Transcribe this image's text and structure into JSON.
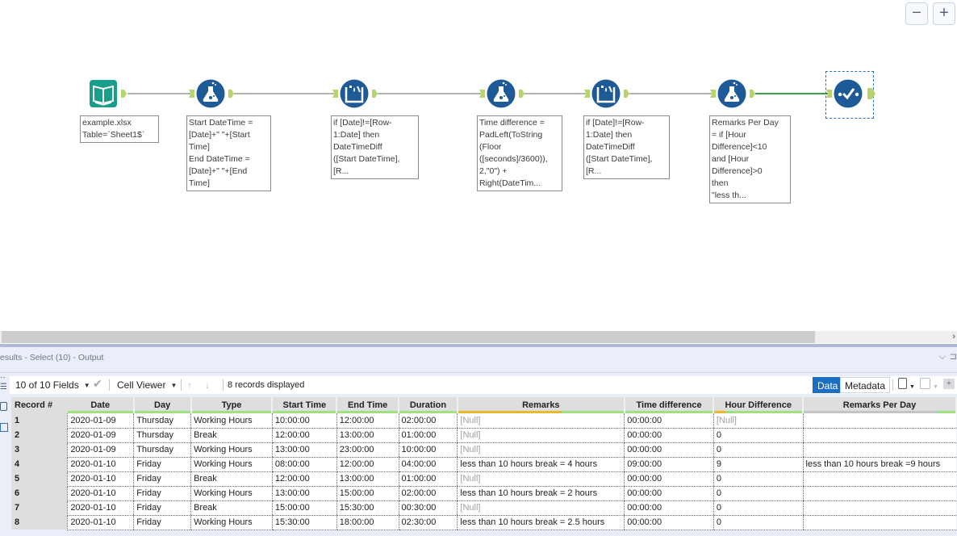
{
  "canvas": {
    "zoom_out_label": "−",
    "zoom_in_label": "+",
    "tools": [
      {
        "id": "input",
        "type": "input-data",
        "icon": "book-icon",
        "color": "#1a9e8c",
        "annotation": "example.xlsx\nTable=`Sheet1$`"
      },
      {
        "id": "formula1",
        "type": "formula",
        "icon": "flask-icon",
        "color": "#1e5a96",
        "annotation": "Start DateTime =\n[Date]+\" \"+[Start\nTime]\nEnd DateTime =\n[Date]+\" \"+[End\nTime]"
      },
      {
        "id": "multirow1",
        "type": "multi-row-formula",
        "icon": "multi-row-icon",
        "color": "#1e5a96",
        "annotation": "if [Date]!=[Row-\n1:Date] then\nDateTimeDiff\n([Start DateTime],\n[R..."
      },
      {
        "id": "formula2",
        "type": "formula",
        "icon": "flask-icon",
        "color": "#1e5a96",
        "annotation": "Time difference =\nPadLeft(ToString\n(Floor\n([seconds]/3600)),\n2,\"0\") +\nRight(DateTim..."
      },
      {
        "id": "multirow2",
        "type": "multi-row-formula",
        "icon": "multi-row-icon",
        "color": "#1e5a96",
        "annotation": "if [Date]!=[Row-\n1:Date] then\nDateTimeDiff\n([Start DateTime],\n[R..."
      },
      {
        "id": "formula3",
        "type": "formula",
        "icon": "flask-icon",
        "color": "#1e5a96",
        "annotation": "Remarks Per Day\n= if [Hour\nDifference]<10\nand [Hour\nDifference]>0\nthen\n\"less th..."
      },
      {
        "id": "select",
        "type": "select",
        "icon": "select-check-icon",
        "color": "#1e5a96",
        "annotation": ""
      }
    ],
    "anchor_color": "#b7d36b",
    "connection_color": "#9a9a9a",
    "selected_connection_color": "#3aa34a"
  },
  "results": {
    "title": "esults - Select (10) - Output",
    "toolbar": {
      "fields_label": "10 of 10 Fields",
      "cell_viewer_label": "Cell Viewer",
      "records_label": "8 records displayed",
      "data_tab": "Data",
      "metadata_tab": "Metadata"
    },
    "columns": [
      {
        "label": "Record #"
      },
      {
        "label": "Date",
        "quality": "ok"
      },
      {
        "label": "Day",
        "quality": "ok"
      },
      {
        "label": "Type",
        "quality": "ok"
      },
      {
        "label": "Start Time",
        "quality": "ok"
      },
      {
        "label": "End Time",
        "quality": "ok"
      },
      {
        "label": "Duration",
        "quality": "ok"
      },
      {
        "label": "Remarks",
        "quality": "partial-null",
        "null_fraction": 0.625
      },
      {
        "label": "Time difference",
        "quality": "ok"
      },
      {
        "label": "Hour Difference",
        "quality": "partial-null",
        "null_fraction": 0.125
      },
      {
        "label": "Remarks Per Day",
        "quality": "partial-empty",
        "empty_fraction": 0.875
      }
    ],
    "rows": [
      [
        "1",
        "2020-01-09",
        "Thursday",
        "Working Hours",
        "10:00:00",
        "12:00:00",
        "02:00:00",
        "[Null]",
        "00:00:00",
        "[Null]",
        ""
      ],
      [
        "2",
        "2020-01-09",
        "Thursday",
        "Break",
        "12:00:00",
        "13:00:00",
        "01:00:00",
        "[Null]",
        "00:00:00",
        "0",
        ""
      ],
      [
        "3",
        "2020-01-09",
        "Thursday",
        "Working Hours",
        "13:00:00",
        "23:00:00",
        "10:00:00",
        "[Null]",
        "00:00:00",
        "0",
        ""
      ],
      [
        "4",
        "2020-01-10",
        "Friday",
        "Working Hours",
        "08:00:00",
        "12:00:00",
        "04:00:00",
        "less than 10 hours break = 4 hours",
        "09:00:00",
        "9",
        "less than 10 hours break =9 hours"
      ],
      [
        "5",
        "2020-01-10",
        "Friday",
        "Break",
        "12:00:00",
        "13:00:00",
        "01:00:00",
        "[Null]",
        "00:00:00",
        "0",
        ""
      ],
      [
        "6",
        "2020-01-10",
        "Friday",
        "Working Hours",
        "13:00:00",
        "15:00:00",
        "02:00:00",
        "less than 10 hours break = 2 hours",
        "00:00:00",
        "0",
        ""
      ],
      [
        "7",
        "2020-01-10",
        "Friday",
        "Break",
        "15:00:00",
        "15:30:00",
        "00:30:00",
        "[Null]",
        "00:00:00",
        "0",
        ""
      ],
      [
        "8",
        "2020-01-10",
        "Friday",
        "Working Hours",
        "15:30:00",
        "18:00:00",
        "02:30:00",
        "less than 10 hours break = 2.5 hours",
        "00:00:00",
        "0",
        ""
      ]
    ]
  }
}
